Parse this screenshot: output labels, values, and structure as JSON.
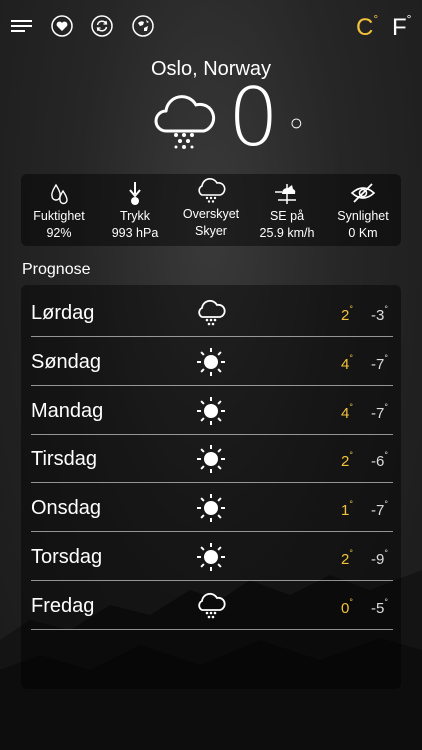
{
  "colors": {
    "accent": "#f2c33a",
    "text": "#ffffff"
  },
  "topbar": {
    "icons": [
      "menu-icon",
      "heart-icon",
      "refresh-icon",
      "globe-icon"
    ],
    "unit_c": "C",
    "unit_f": "F",
    "active_unit": "C"
  },
  "current": {
    "location": "Oslo, Norway",
    "temperature": "0",
    "condition_icon": "snow-cloud-icon"
  },
  "stats": [
    {
      "icon": "humidity-icon",
      "label": "Fuktighet",
      "value": "92%"
    },
    {
      "icon": "pressure-icon",
      "label": "Trykk",
      "value": "993 hPa"
    },
    {
      "icon": "cloud-icon",
      "label": "Overskyet",
      "value": "Skyer"
    },
    {
      "icon": "wind-vane-icon",
      "label": "SE på",
      "value": "25.9 km/h"
    },
    {
      "icon": "visibility-off-icon",
      "label": "Synlighet",
      "value": "0 Km"
    }
  ],
  "forecast": {
    "title": "Prognose",
    "days": [
      {
        "day": "Lørdag",
        "icon": "snow-cloud-icon",
        "high": "2",
        "low": "-3"
      },
      {
        "day": "Søndag",
        "icon": "sun-icon",
        "high": "4",
        "low": "-7"
      },
      {
        "day": "Mandag",
        "icon": "sun-icon",
        "high": "4",
        "low": "-7"
      },
      {
        "day": "Tirsdag",
        "icon": "sun-icon",
        "high": "2",
        "low": "-6"
      },
      {
        "day": "Onsdag",
        "icon": "sun-icon",
        "high": "1",
        "low": "-7"
      },
      {
        "day": "Torsdag",
        "icon": "sun-icon",
        "high": "2",
        "low": "-9"
      },
      {
        "day": "Fredag",
        "icon": "snow-cloud-icon",
        "high": "0",
        "low": "-5"
      }
    ]
  },
  "degree_symbol": "°"
}
